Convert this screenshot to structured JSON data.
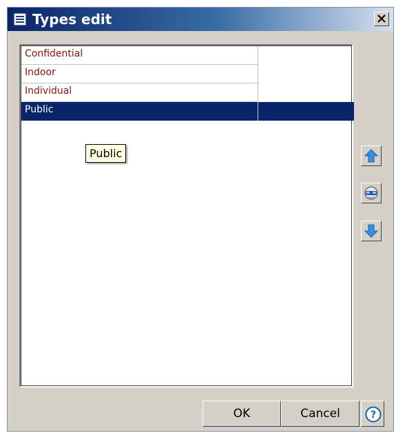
{
  "window": {
    "title": "Types edit"
  },
  "list": {
    "items": [
      {
        "label": "Confidential",
        "selected": false
      },
      {
        "label": "Indoor",
        "selected": false
      },
      {
        "label": "Individual",
        "selected": false
      },
      {
        "label": "Public",
        "selected": true
      }
    ]
  },
  "tooltip": {
    "text": "Public"
  },
  "side_buttons": {
    "up_icon": "arrow-up-icon",
    "edit_icon": "face-icon",
    "down_icon": "arrow-down-icon"
  },
  "buttons": {
    "ok_label": "OK",
    "cancel_label": "Cancel"
  },
  "colors": {
    "selection": "#0a246a",
    "item_text": "#8b1010",
    "tooltip_bg": "#ffffe1"
  }
}
